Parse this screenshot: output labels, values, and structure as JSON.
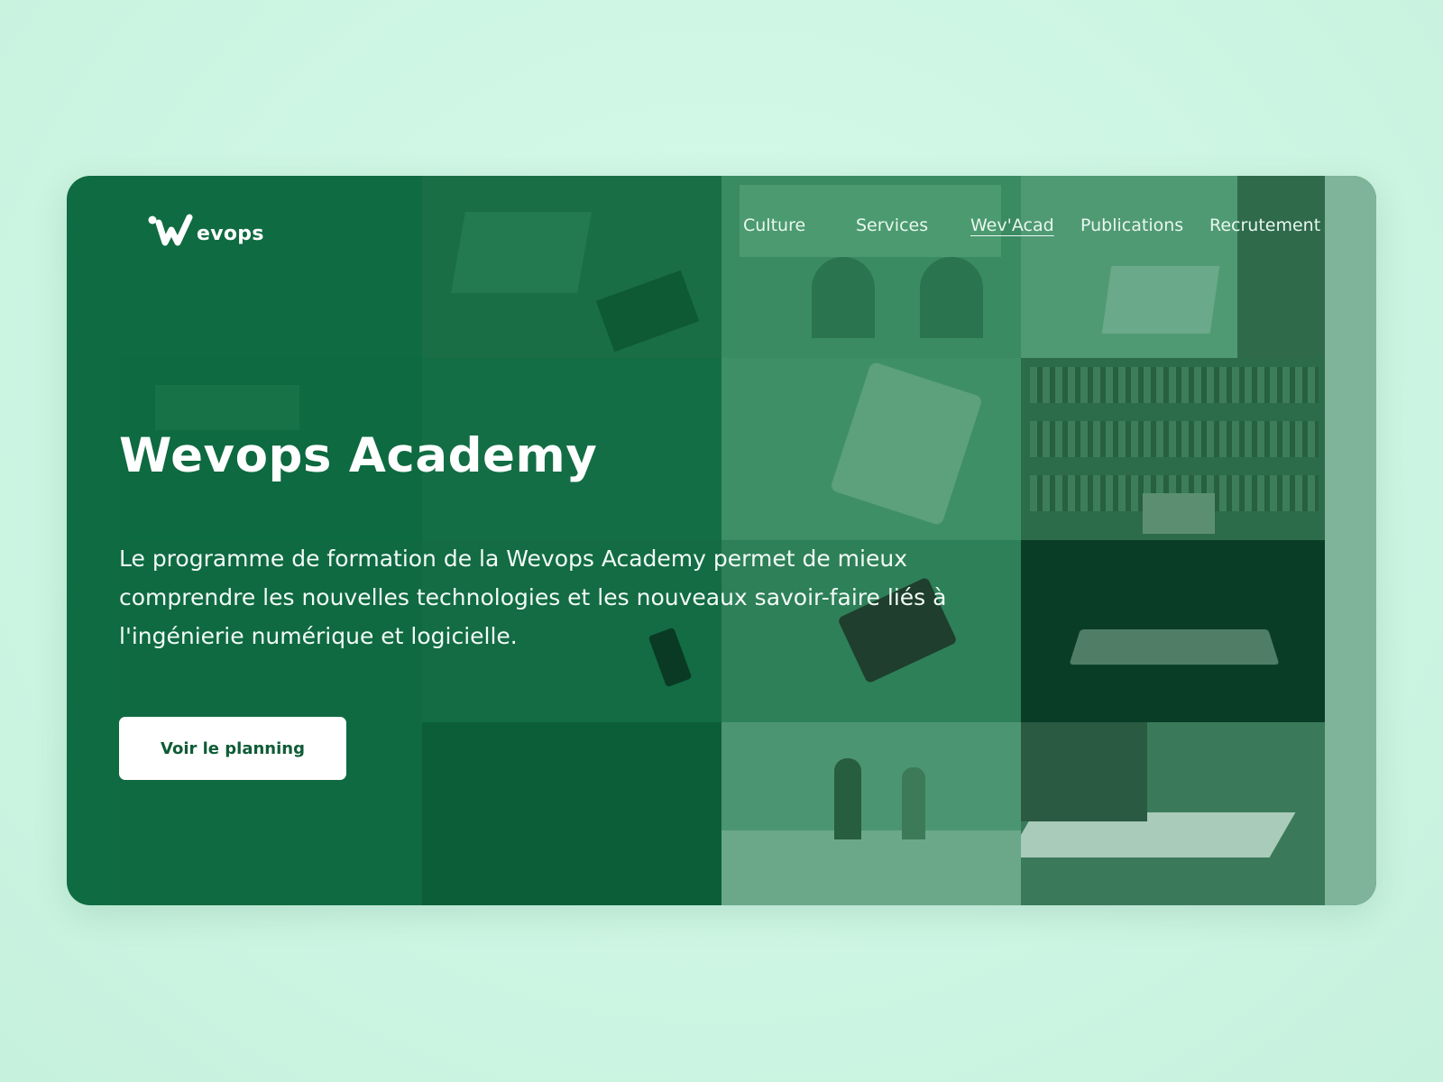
{
  "brand": {
    "logo_text": "evops",
    "logo_icon": "wevops-w-logo",
    "color_primary": "#0f6b41",
    "color_background": "#d2f8e8"
  },
  "nav": {
    "items": [
      {
        "label": "Culture",
        "active": false
      },
      {
        "label": "Services",
        "active": false
      },
      {
        "label": "Wev'Acad",
        "active": true
      },
      {
        "label": "Publications",
        "active": false
      },
      {
        "label": "Recrutement",
        "active": false
      }
    ]
  },
  "hero": {
    "title": "Wevops Academy",
    "description": "Le programme de formation de la Wevops Academy permet de mieux comprendre les nouvelles technologies et les nouveaux savoir-faire liés à l'ingénierie numérique et logicielle.",
    "cta_label": "Voir le planning"
  }
}
